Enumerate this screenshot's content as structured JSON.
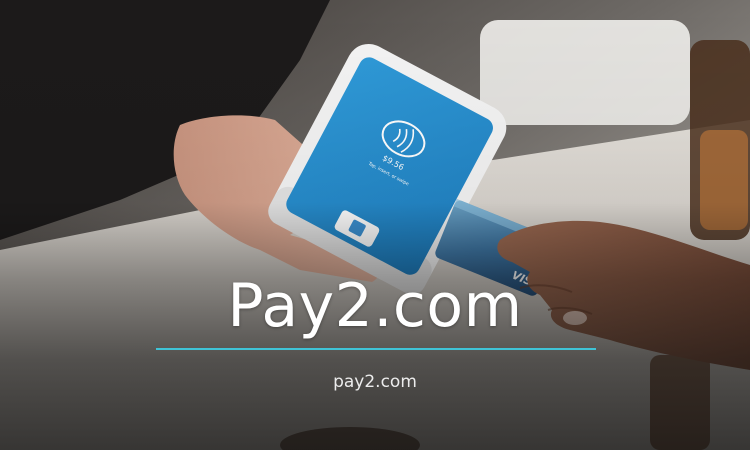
{
  "hero": {
    "title": "Pay2.com",
    "subtitle": "pay2.com",
    "accent_color": "#3fc3d6"
  },
  "terminal": {
    "amount": "$9.56",
    "prompt": "Tap, insert, or swipe"
  },
  "card": {
    "brand": "VISA"
  }
}
